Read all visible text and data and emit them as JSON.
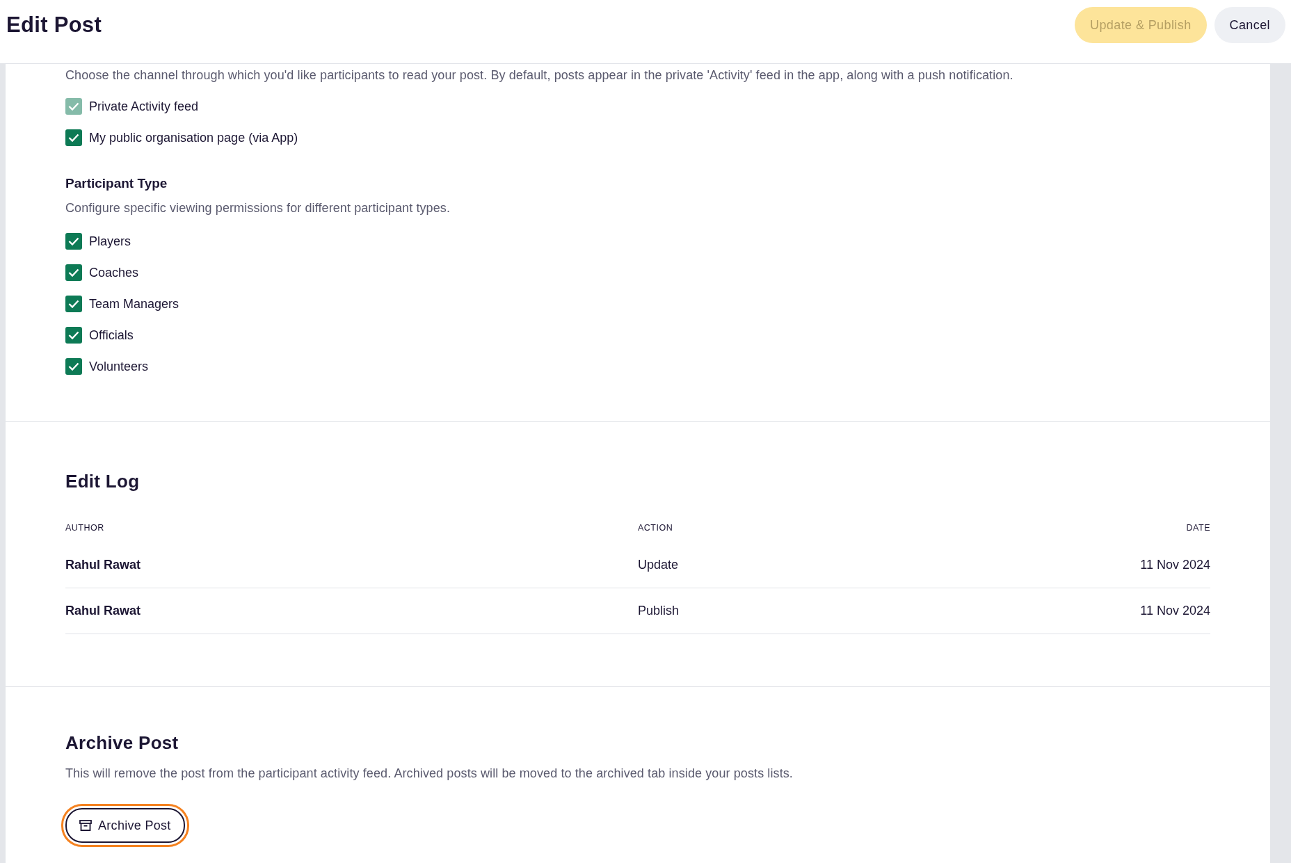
{
  "header": {
    "title": "Edit Post",
    "buttons": [
      {
        "label": "Update & Publish",
        "kind": "primary",
        "disabled": true
      },
      {
        "label": "Cancel",
        "kind": "secondary",
        "disabled": false
      }
    ]
  },
  "channel": {
    "description": "Choose the channel through which you'd like participants to read your post. By default, posts appear in the private 'Activity' feed in the app, along with a push notification.",
    "options": [
      {
        "label": "Private Activity feed",
        "checked": true,
        "disabled": true
      },
      {
        "label": "My public organisation page (via App)",
        "checked": true,
        "disabled": false
      }
    ]
  },
  "participant_type": {
    "title": "Participant Type",
    "description": "Configure specific viewing permissions for different participant types.",
    "options": [
      {
        "label": "Players",
        "checked": true,
        "disabled": false
      },
      {
        "label": "Coaches",
        "checked": true,
        "disabled": false
      },
      {
        "label": "Team Managers",
        "checked": true,
        "disabled": false
      },
      {
        "label": "Officials",
        "checked": true,
        "disabled": false
      },
      {
        "label": "Volunteers",
        "checked": true,
        "disabled": false
      }
    ]
  },
  "edit_log": {
    "title": "Edit Log",
    "columns": [
      "AUTHOR",
      "ACTION",
      "DATE"
    ],
    "rows": [
      [
        "Rahul Rawat",
        "Update",
        "11 Nov 2024"
      ],
      [
        "Rahul Rawat",
        "Publish",
        "11 Nov 2024"
      ]
    ]
  },
  "archive": {
    "title": "Archive Post",
    "description": "This will remove the post from the participant activity feed. Archived posts will be moved to the archived tab inside your posts lists.",
    "button": {
      "label": "Archive Post",
      "focused": true
    }
  }
}
